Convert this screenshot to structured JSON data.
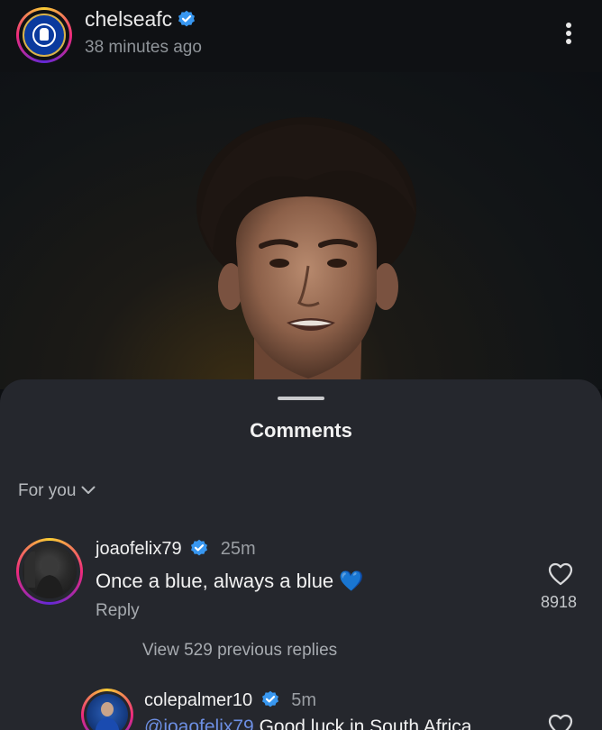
{
  "post": {
    "username": "chelseafc",
    "time": "38 minutes ago",
    "verified": true,
    "more_icon": "more-vertical-icon"
  },
  "sheet": {
    "title": "Comments",
    "filter_label": "For you"
  },
  "comments": [
    {
      "username": "joaofelix79",
      "verified": true,
      "time": "25m",
      "text": "Once a blue, always a blue",
      "emoji": "💙",
      "reply_label": "Reply",
      "like_count": "8918",
      "view_replies": "View 529 previous replies"
    },
    {
      "username": "colepalmer10",
      "verified": true,
      "time": "5m",
      "mention": "@joaofelix79",
      "text_rest": " Good luck in South Africa"
    }
  ],
  "colors": {
    "verified_blue": "#3897f0",
    "mention_blue": "#6d8fe3",
    "sheet_bg": "#25272d"
  }
}
